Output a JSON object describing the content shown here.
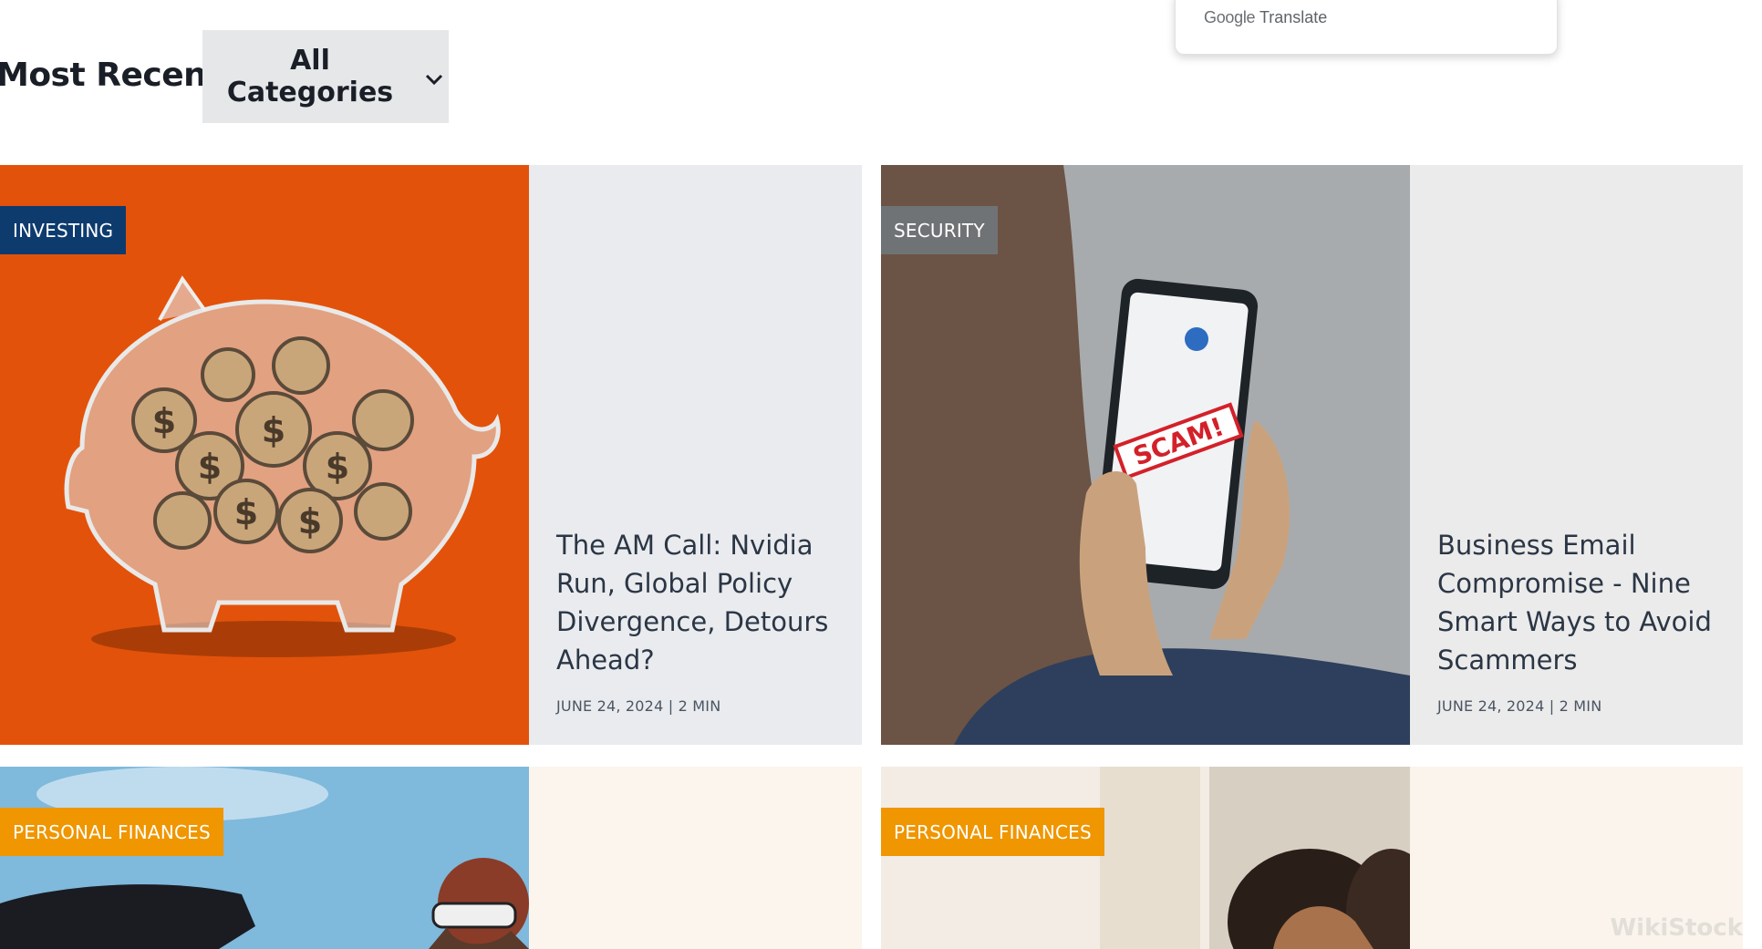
{
  "section": {
    "title": "Most Recent"
  },
  "filter": {
    "label": "All Categories"
  },
  "google_translate": {
    "brand": "Google",
    "label": "Translate"
  },
  "cards": [
    {
      "category": "INVESTING",
      "category_color": "#0d3b6e",
      "image_bg": "#e3520a",
      "text_bg": "#e9ebee",
      "title": "The AM Call:  Nvidia Run, Global Policy Divergence, Detours Ahead?",
      "meta": "JUNE 24, 2024 | 2 MIN",
      "image": "piggy-bank-coins"
    },
    {
      "category": "SECURITY",
      "category_color": "#707375",
      "image_bg": "#a8abad",
      "text_bg": "#ebebeb",
      "title": "Business Email Compromise - Nine Smart Ways to Avoid Scammers",
      "meta": "JUNE 24, 2024 | 2 MIN",
      "image": "phone-scam-message",
      "phone_stamp": "SCAM!"
    },
    {
      "category": "PERSONAL FINANCES",
      "category_color": "#ef9600",
      "image_bg": "#7fb9dc",
      "text_bg": "#fbf5ee",
      "image": "woman-with-car"
    },
    {
      "category": "PERSONAL FINANCES",
      "category_color": "#ef9600",
      "image_bg": "#f2ece4",
      "text_bg": "#fbf4ec",
      "image": "couple-embracing"
    }
  ],
  "watermark": "WikiStock"
}
